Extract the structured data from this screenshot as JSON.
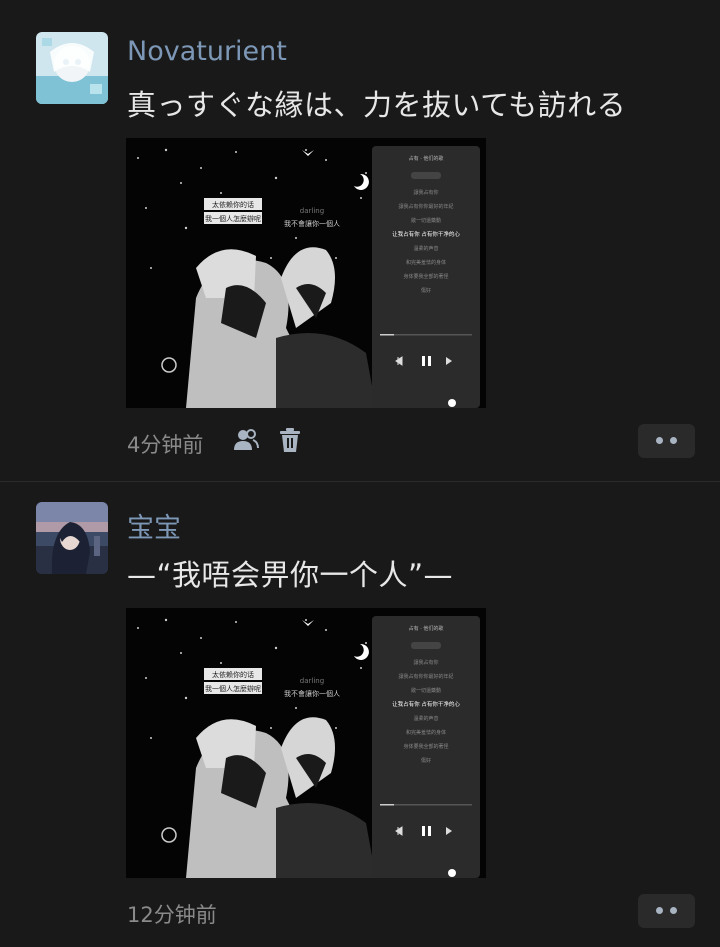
{
  "posts": [
    {
      "author": "Novaturient",
      "message": "真っすぐな縁は、力を抜いても訪れる",
      "time": "4分钟前",
      "icons": [
        "user-icon",
        "trash-icon",
        "more-dots-icon"
      ],
      "screenshot": {
        "lyric_left_1": "太依赖你的话",
        "lyric_left_2": "我一個人怎麼辦呢",
        "lyric_center_1": "darling",
        "lyric_center_2": "我不會讓你一個人",
        "player_title": "占有 · 他们的歌",
        "player_lines": [
          "讓我占有你",
          "讓我占有你你最好的年紀",
          "敞一切還藥動",
          "让我占有你 占有你干净的心",
          "溫柔的声音",
          "和完美羞怯的身体",
          "身体要我全部的著怪",
          "傷好"
        ]
      }
    },
    {
      "author": "宝宝",
      "message": "—“我唔会畀你一个人”—",
      "time": "12分钟前",
      "icons": [
        "more-dots-icon"
      ],
      "screenshot": {
        "lyric_left_1": "太依赖你的话",
        "lyric_left_2": "我一個人怎麼辦呢",
        "lyric_center_1": "darling",
        "lyric_center_2": "我不會讓你一個人",
        "player_title": "占有 · 他们的歌",
        "player_lines": [
          "讓我占有你",
          "讓我占有你你最好的年紀",
          "敞一切還藥動",
          "让我占有你 占有你干净的心",
          "溫柔的声音",
          "和完美羞怯的身体",
          "身体要我全部的著怪",
          "傷好"
        ]
      }
    }
  ],
  "colors": {
    "background": "#191919",
    "name": "#7d97b6",
    "message": "#e7e7e7",
    "time": "#8a8a8a",
    "icon": "#a9b4c2"
  }
}
